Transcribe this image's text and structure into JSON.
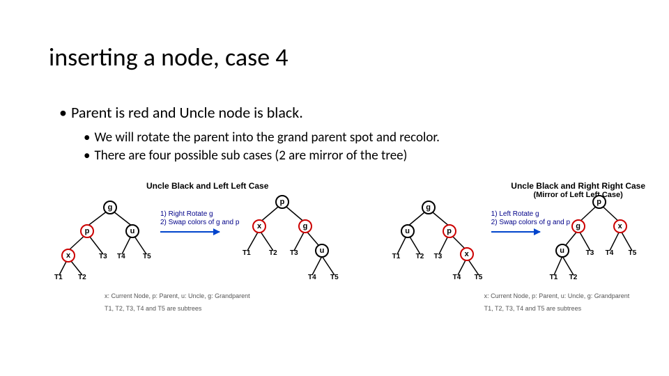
{
  "title": "inserting a node, case 4",
  "bullets": {
    "l1": "Parent is red and Uncle node is black.",
    "l2a": "We will rotate the parent into the grand parent spot and recolor.",
    "l2b": "There are four possible sub cases (2 are mirror of the tree)"
  },
  "left": {
    "title": "Uncle Black and Left Left Case",
    "step1": "1) Right Rotate g",
    "step2": "2) Swap colors of g and p",
    "legend": "x: Current Node, p: Parent, u: Uncle, g: Grandparent",
    "note": "T1, T2, T3, T4 and T5 are subtrees"
  },
  "right": {
    "title": "Uncle Black and Right Right Case",
    "sub": "(Mirror of Left Left Case)",
    "step1": "1) Left Rotate g",
    "step2": "2) Swap colors of g and p",
    "legend": "x: Current Node, p: Parent, u: Uncle, g: Grandparent",
    "note": "T1, T2, T3, T4 and T5 are subtrees"
  },
  "labels": {
    "g": "g",
    "p": "p",
    "u": "u",
    "x": "x",
    "T1": "T1",
    "T2": "T2",
    "T3": "T3",
    "T4": "T4",
    "T5": "T5"
  }
}
